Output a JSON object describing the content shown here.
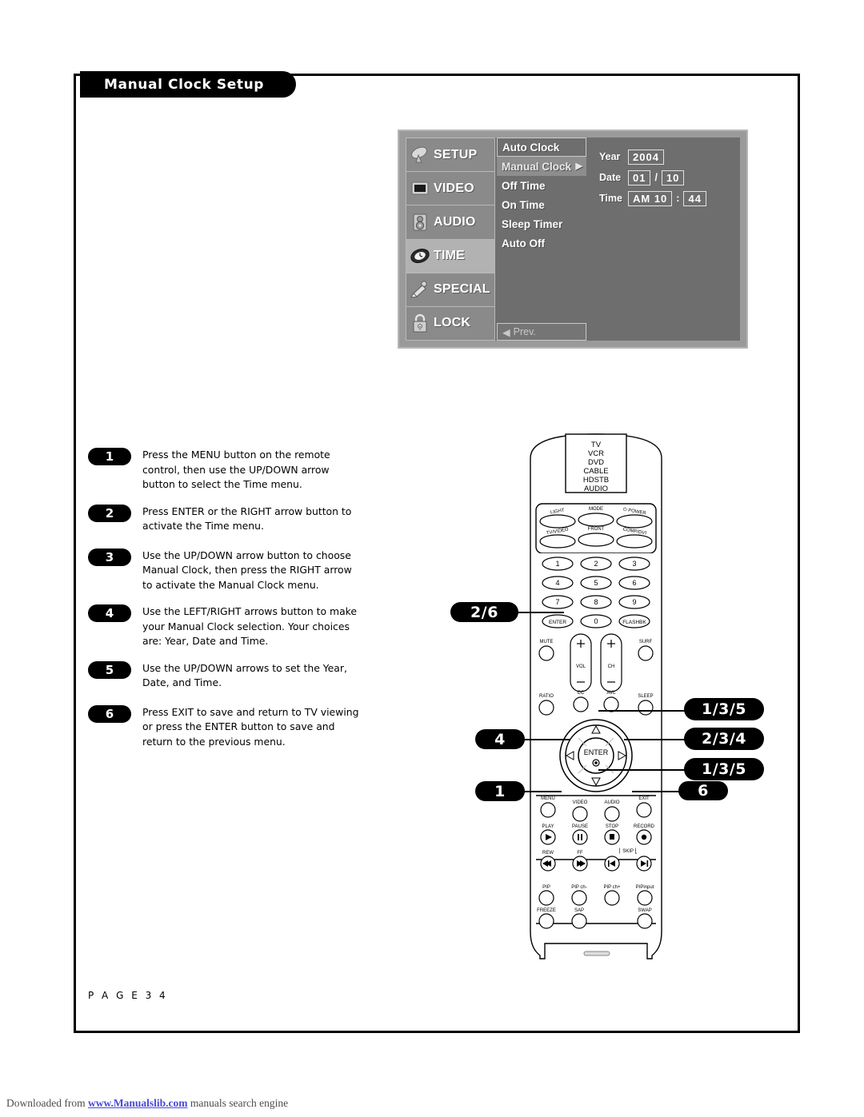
{
  "header": {
    "title": "Manual Clock Setup"
  },
  "osd": {
    "categories": [
      {
        "label": "SETUP",
        "icon": "satellite-dish-icon",
        "selected": false
      },
      {
        "label": "VIDEO",
        "icon": "screen-icon",
        "selected": false
      },
      {
        "label": "AUDIO",
        "icon": "speaker-icon",
        "selected": false
      },
      {
        "label": "TIME",
        "icon": "clock-icon",
        "selected": true
      },
      {
        "label": "SPECIAL",
        "icon": "paintbrush-icon",
        "selected": false
      },
      {
        "label": "LOCK",
        "icon": "padlock-icon",
        "selected": false
      }
    ],
    "menu_items": [
      {
        "label": "Auto Clock",
        "boxed": true,
        "highlighted": false,
        "arrow": ""
      },
      {
        "label": "Manual Clock",
        "boxed": false,
        "highlighted": true,
        "arrow": "▶"
      },
      {
        "label": "Off Time",
        "boxed": false,
        "highlighted": false,
        "arrow": ""
      },
      {
        "label": "On Time",
        "boxed": false,
        "highlighted": false,
        "arrow": ""
      },
      {
        "label": "Sleep Timer",
        "boxed": false,
        "highlighted": false,
        "arrow": ""
      },
      {
        "label": "Auto Off",
        "boxed": false,
        "highlighted": false,
        "arrow": ""
      }
    ],
    "prev_label": "Prev.",
    "prev_arrow": "◀",
    "values": {
      "year_label": "Year",
      "year_value": "2004",
      "date_label": "Date",
      "date_month": "01",
      "date_sep": "/",
      "date_day": "10",
      "time_label": "Time",
      "time_hour": "AM 10",
      "time_sep": ":",
      "time_min": "44"
    },
    "colors": {
      "panel_bg": "#9a9a9a",
      "inner_bg": "#6e6e6e",
      "cat_bg": "#8a8a8a",
      "cat_selected": "#b2b2b2"
    }
  },
  "steps": [
    {
      "num": "1",
      "text": "Press the MENU button on the remote control, then use the UP/DOWN arrow button to select the Time menu."
    },
    {
      "num": "2",
      "text": "Press ENTER or the RIGHT arrow button to activate the Time menu."
    },
    {
      "num": "3",
      "text": "Use the UP/DOWN arrow button to choose Manual Clock, then press the RIGHT arrow to activate the Manual Clock menu."
    },
    {
      "num": "4",
      "text": "Use the LEFT/RIGHT arrows button to make your Manual Clock selection. Your choices are: Year, Date and Time."
    },
    {
      "num": "5",
      "text": "Use the UP/DOWN arrows to set the Year, Date, and Time."
    },
    {
      "num": "6",
      "text": "Press EXIT to save and return to TV viewing or press the ENTER button to save and return to the previous menu."
    }
  ],
  "callouts": {
    "enter_left": "2/6",
    "left_arrow": "4",
    "menu_btn": "1",
    "up_arrow": "1/3/5",
    "right_arrow": "2/3/4",
    "down_arrow": "1/3/5",
    "exit_btn": "6"
  },
  "remote": {
    "mode_list": [
      "TV",
      "VCR",
      "DVD",
      "CABLE",
      "HDSTB",
      "AUDIO"
    ],
    "top_row1": [
      "LIGHT",
      "MODE",
      "POWER"
    ],
    "top_row2": [
      "TV/VIDEO",
      "FRONT",
      "COMP/DVI"
    ],
    "keypad": [
      "1",
      "2",
      "3",
      "4",
      "5",
      "6",
      "7",
      "8",
      "9",
      "ENTER",
      "0",
      "FLASHBK"
    ],
    "mute": "MUTE",
    "vol": "VOL",
    "ch": "CH",
    "surf": "SURF",
    "ratio": "RATIO",
    "cc": "CC",
    "avl": "AVL",
    "sleep": "SLEEP",
    "enter": "ENTER",
    "menu": "MENU",
    "video": "VIDEO",
    "audio": "AUDIO",
    "exit": "EXIT",
    "transport1": [
      "PLAY",
      "PAUSE",
      "STOP",
      "RECORD"
    ],
    "transport2": [
      "REW",
      "FF",
      "SKIP"
    ],
    "pip_row1": [
      "PIP",
      "PIP ch-",
      "PIP ch+",
      "PIPinput"
    ],
    "pip_row2": [
      "FREEZE",
      "SAP",
      "SWAP"
    ]
  },
  "footer": {
    "page_label": "P A G E   3 4",
    "download_prefix": "Downloaded from ",
    "download_link": "www.Manualslib.com",
    "download_suffix": " manuals search engine"
  }
}
